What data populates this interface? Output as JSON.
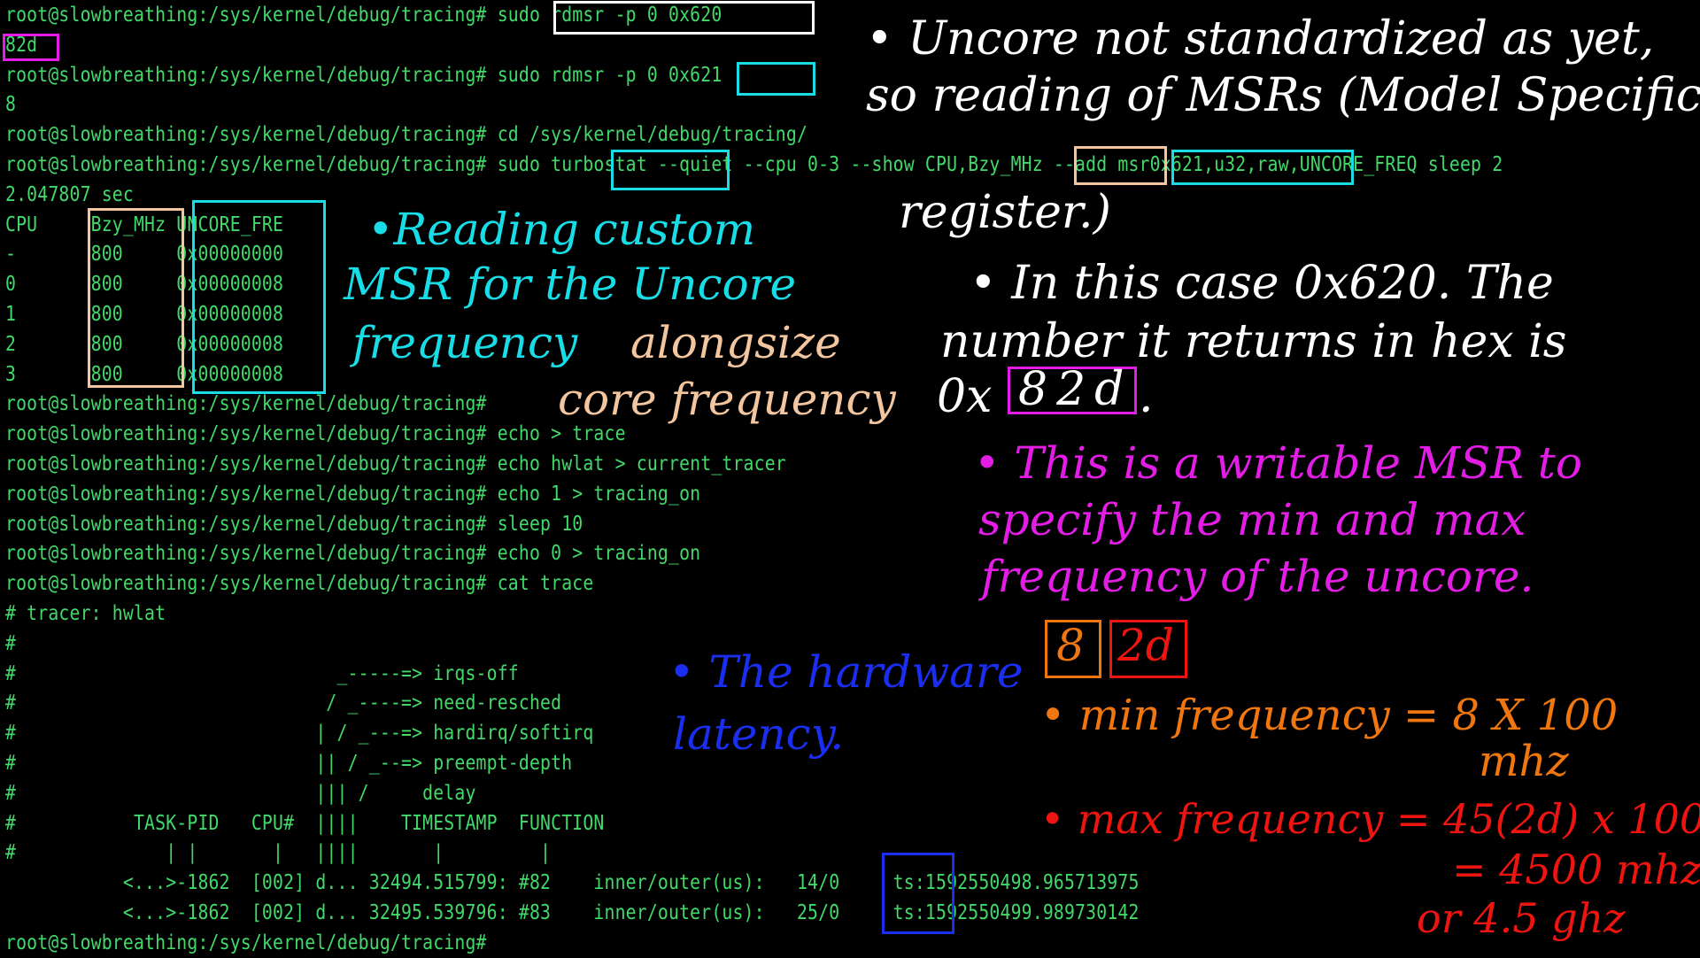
{
  "terminal": {
    "lines": [
      "root@slowbreathing:/sys/kernel/debug/tracing# sudo rdmsr -p 0 0x620",
      "82d",
      "root@slowbreathing:/sys/kernel/debug/tracing# sudo rdmsr -p 0 0x621",
      "8",
      "root@slowbreathing:/sys/kernel/debug/tracing# cd /sys/kernel/debug/tracing/",
      "root@slowbreathing:/sys/kernel/debug/tracing# sudo turbostat --quiet --cpu 0-3 --show CPU,Bzy_MHz --add msr0x621,u32,raw,UNCORE_FREQ sleep 2",
      "2.047807 sec",
      "CPU     Bzy_MHz UNCORE_FRE",
      "-       800     0x00000000",
      "0       800     0x00000008",
      "1       800     0x00000008",
      "2       800     0x00000008",
      "3       800     0x00000008",
      "root@slowbreathing:/sys/kernel/debug/tracing#",
      "root@slowbreathing:/sys/kernel/debug/tracing# echo > trace",
      "root@slowbreathing:/sys/kernel/debug/tracing# echo hwlat > current_tracer",
      "root@slowbreathing:/sys/kernel/debug/tracing# echo 1 > tracing_on",
      "root@slowbreathing:/sys/kernel/debug/tracing# sleep 10",
      "root@slowbreathing:/sys/kernel/debug/tracing# echo 0 > tracing_on",
      "root@slowbreathing:/sys/kernel/debug/tracing# cat trace",
      "# tracer: hwlat",
      "#",
      "#                              _-----=> irqs-off",
      "#                             / _----=> need-resched",
      "#                            | / _---=> hardirq/softirq",
      "#                            || / _--=> preempt-depth",
      "#                            ||| /     delay",
      "#           TASK-PID   CPU#  ||||    TIMESTAMP  FUNCTION",
      "#              | |       |   ||||       |         |",
      "           <...>-1862  [002] d... 32494.515799: #82    inner/outer(us):   14/0     ts:1592550498.965713975",
      "           <...>-1862  [002] d... 32495.539796: #83    inner/outer(us):   25/0     ts:1592550499.989730142",
      "root@slowbreathing:/sys/kernel/debug/tracing#"
    ]
  },
  "annotations": {
    "white": [
      "• Uncore not standardized as yet,",
      "so reading of MSRs (Model Specific",
      "register.)",
      "• In this case 0x620. The",
      "number it returns in hex is",
      "0x",
      "82d",
      "."
    ],
    "cyan": [
      "•Reading custom",
      "MSR for the Uncore",
      "frequency"
    ],
    "peach": [
      "alongsize",
      "core frequency"
    ],
    "magenta": [
      "• This is a writable MSR to",
      "specify the min and max",
      "frequency of the uncore."
    ],
    "blue": [
      "• The hardware",
      "latency."
    ],
    "orange": {
      "digit": "8",
      "line1": "• min frequency = 8 X 100",
      "line2": "mhz"
    },
    "red": {
      "digits": "2d",
      "line1": "• max frequency = 45(2d) x 100",
      "line2": "= 4500 mhz",
      "line3": "or 4.5 ghz"
    }
  },
  "colors": {
    "background": "#000000",
    "terminal_text": "#42d96a",
    "box_white": "#ffffff",
    "box_cyan": "#18dde6",
    "box_peach": "#f4c6a0",
    "box_magenta": "#e41de6",
    "box_blue": "#1a2ef0",
    "box_orange": "#f0770f",
    "box_red": "#ee1410"
  }
}
